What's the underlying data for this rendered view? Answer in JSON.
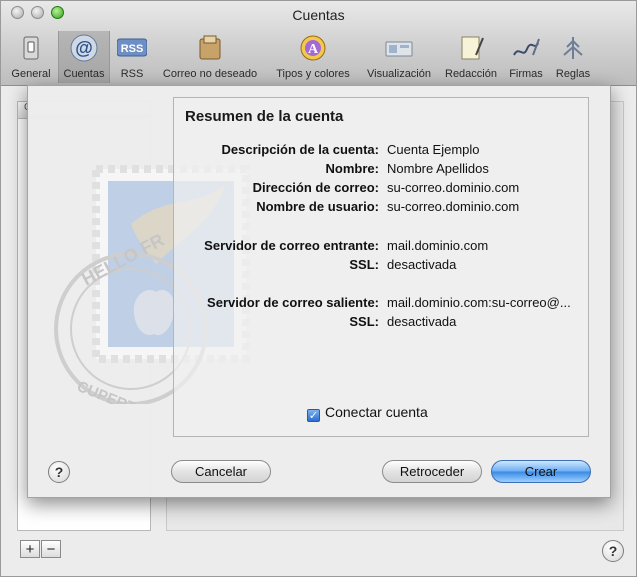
{
  "window": {
    "title": "Cuentas"
  },
  "toolbar": {
    "items": [
      {
        "label": "General",
        "icon": "switch-icon"
      },
      {
        "label": "Cuentas",
        "icon": "at-sign-icon",
        "selected": true
      },
      {
        "label": "RSS",
        "icon": "rss-icon",
        "badge": "RSS"
      },
      {
        "label": "Correo no deseado",
        "icon": "junk-mail-icon"
      },
      {
        "label": "Tipos y colores",
        "icon": "fonts-colors-icon",
        "glyph": "A"
      },
      {
        "label": "Visualización",
        "icon": "viewing-icon"
      },
      {
        "label": "Redacción",
        "icon": "composing-icon"
      },
      {
        "label": "Firmas",
        "icon": "signature-icon"
      },
      {
        "label": "Reglas",
        "icon": "rules-icon"
      }
    ]
  },
  "background": {
    "list_header": "C",
    "add_label": "+",
    "remove_label": "−",
    "help_label": "?"
  },
  "sheet": {
    "panel_title": "Resumen de la cuenta",
    "rows": [
      {
        "label": "Descripción de la cuenta:",
        "value": "Cuenta Ejemplo"
      },
      {
        "label": "Nombre:",
        "value": "Nombre Apellidos"
      },
      {
        "label": "Dirección de correo:",
        "value": "su-correo.dominio.com"
      },
      {
        "label": "Nombre de usuario:",
        "value": "su-correo.dominio.com"
      },
      {
        "label": "Servidor de correo entrante:",
        "value": "mail.dominio.com"
      },
      {
        "label": "SSL:",
        "value": "desactivada"
      },
      {
        "label": "Servidor de correo saliente:",
        "value": "mail.dominio.com:su-correo@..."
      },
      {
        "label": "SSL:",
        "value": "desactivada"
      }
    ],
    "connect_checkbox": {
      "label": "Conectar cuenta",
      "checked": true
    },
    "help_label": "?",
    "buttons": {
      "cancel": "Cancelar",
      "back": "Retroceder",
      "create": "Crear"
    }
  },
  "stamp": {
    "text_top": "HELLO FR",
    "text_bottom": "CUPERTINO, CA"
  },
  "colors": {
    "accent": "#3b8ae6",
    "stamp_blue": "#9bb7e0"
  }
}
